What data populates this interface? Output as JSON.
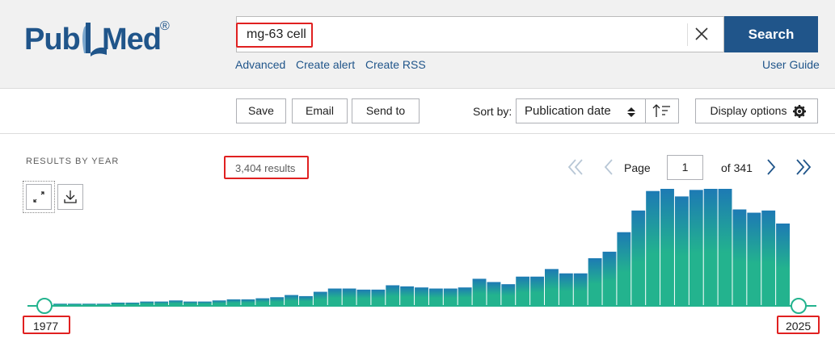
{
  "logo": {
    "text_left": "Pub",
    "text_right": "Med",
    "registered": "®"
  },
  "search": {
    "value": "mg-63 cell",
    "placeholder": "",
    "button_label": "Search"
  },
  "links": {
    "advanced": "Advanced",
    "create_alert": "Create alert",
    "create_rss": "Create RSS",
    "user_guide": "User Guide"
  },
  "toolbar": {
    "save": "Save",
    "email": "Email",
    "send_to": "Send to",
    "sort_by_label": "Sort by:",
    "sort_value": "Publication date",
    "display_options": "Display options"
  },
  "results": {
    "section_title": "RESULTS BY YEAR",
    "count": "3,404 results"
  },
  "pagination": {
    "page_label": "Page",
    "current_page": "1",
    "of_label": "of 341"
  },
  "timeline": {
    "start_year": "1977",
    "end_year": "2025"
  },
  "icons": {
    "clear": "close-icon",
    "sort_order": "sort-descending-icon",
    "settings": "gear-icon",
    "expand": "expand-icon",
    "download": "download-icon",
    "first": "double-chevron-left-icon",
    "prev": "chevron-left-icon",
    "next": "chevron-right-icon",
    "last": "double-chevron-right-icon"
  },
  "colors": {
    "brand": "#20558a",
    "bar_top": "#1d7ab4",
    "bar_bottom": "#23b38e",
    "highlight": "#e02020"
  },
  "chart_data": {
    "type": "bar",
    "x_range": [
      "1977",
      "2025"
    ],
    "values": [
      2,
      2,
      2,
      2,
      3,
      3,
      4,
      4,
      5,
      4,
      4,
      5,
      6,
      6,
      7,
      8,
      10,
      9,
      13,
      16,
      16,
      15,
      15,
      19,
      18,
      17,
      16,
      16,
      17,
      25,
      22,
      20,
      27,
      27,
      34,
      30,
      30,
      44,
      50,
      68,
      88,
      106,
      108,
      101,
      107,
      108,
      108,
      89,
      86,
      88,
      76
    ]
  }
}
